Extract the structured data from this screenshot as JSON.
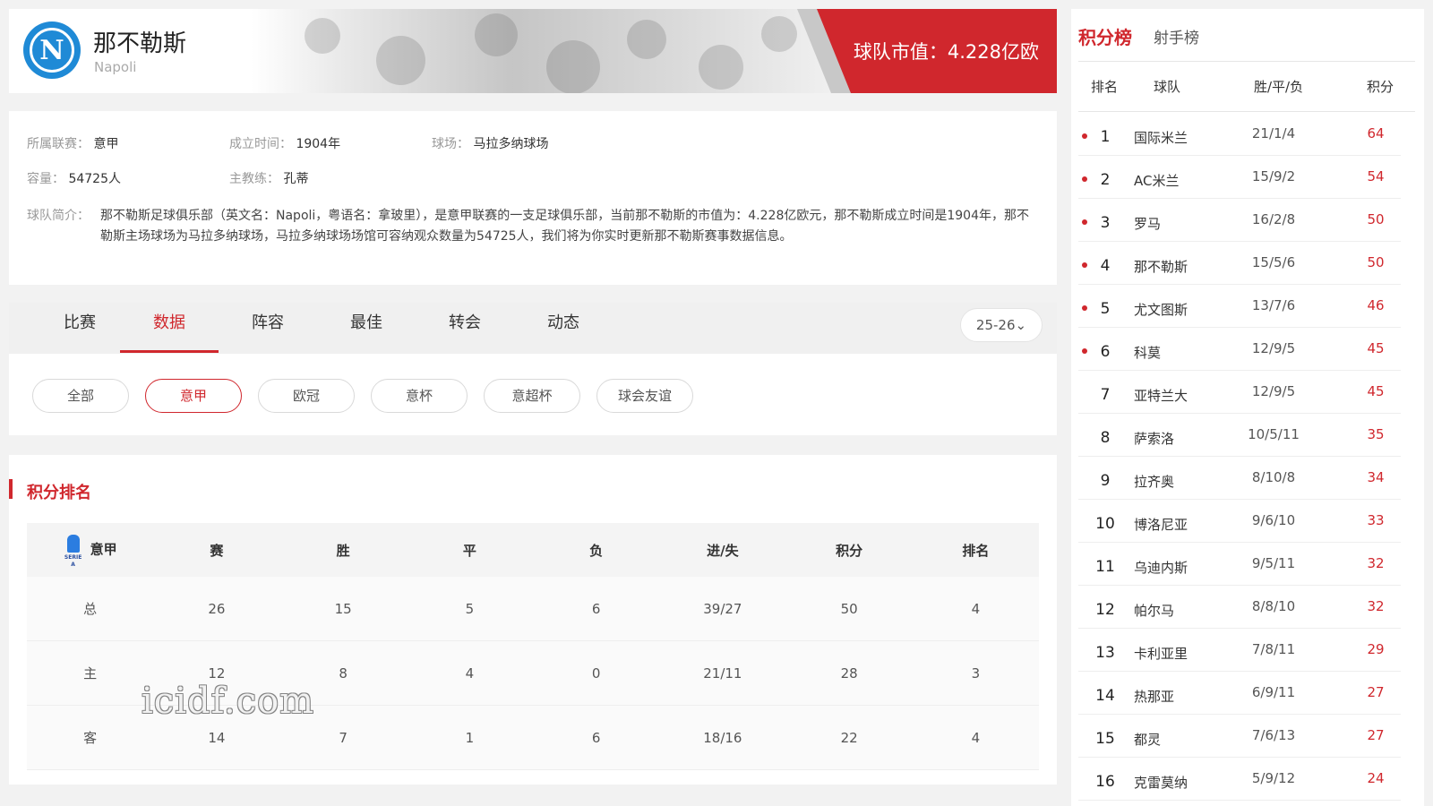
{
  "header": {
    "team_name": "那不勒斯",
    "team_name_en": "Napoli",
    "logo_letter": "N",
    "market_value": "球队市值：4.228亿欧"
  },
  "info": {
    "league_label": "所属联赛：",
    "league_value": "意甲",
    "founded_label": "成立时间：",
    "founded_value": "1904年",
    "stadium_label": "球场：",
    "stadium_value": "马拉多纳球场",
    "capacity_label": "容量：",
    "capacity_value": "54725人",
    "coach_label": "主教练：",
    "coach_value": "孔蒂",
    "intro_label": "球队简介：",
    "intro_value": "那不勒斯足球俱乐部（英文名：Napoli，粤语名：拿玻里），是意甲联赛的一支足球俱乐部，当前那不勒斯的市值为：4.228亿欧元，那不勒斯成立时间是1904年，那不勒斯主场球场为马拉多纳球场，马拉多纳球场场馆可容纳观众数量为54725人，我们将为你实时更新那不勒斯赛事数据信息。"
  },
  "tabs": [
    "比赛",
    "数据",
    "阵容",
    "最佳",
    "转会",
    "动态"
  ],
  "active_tab": "数据",
  "season": "25-26⌄",
  "filters": [
    "全部",
    "意甲",
    "欧冠",
    "意杯",
    "意超杯",
    "球会友谊"
  ],
  "active_filter": "意甲",
  "ranking": {
    "title": "积分排名",
    "logo_text": "SERIE A",
    "headers": [
      "意甲",
      "赛",
      "胜",
      "平",
      "负",
      "进/失",
      "积分",
      "排名"
    ],
    "rows": [
      [
        "总",
        "26",
        "15",
        "5",
        "6",
        "39/27",
        "50",
        "4"
      ],
      [
        "主",
        "12",
        "8",
        "4",
        "0",
        "21/11",
        "28",
        "3"
      ],
      [
        "客",
        "14",
        "7",
        "1",
        "6",
        "18/16",
        "22",
        "4"
      ]
    ]
  },
  "watermark": "icidf.com",
  "standings": {
    "tab_points": "积分榜",
    "tab_scorers": "射手榜",
    "headers": [
      "排名",
      "球队",
      "胜/平/负",
      "积分"
    ],
    "rows": [
      {
        "rank": "1",
        "team": "国际米兰",
        "wdl": "21/1/4",
        "pts": "64",
        "dot": true
      },
      {
        "rank": "2",
        "team": "AC米兰",
        "wdl": "15/9/2",
        "pts": "54",
        "dot": true
      },
      {
        "rank": "3",
        "team": "罗马",
        "wdl": "16/2/8",
        "pts": "50",
        "dot": true
      },
      {
        "rank": "4",
        "team": "那不勒斯",
        "wdl": "15/5/6",
        "pts": "50",
        "dot": true
      },
      {
        "rank": "5",
        "team": "尤文图斯",
        "wdl": "13/7/6",
        "pts": "46",
        "dot": true
      },
      {
        "rank": "6",
        "team": "科莫",
        "wdl": "12/9/5",
        "pts": "45",
        "dot": true
      },
      {
        "rank": "7",
        "team": "亚特兰大",
        "wdl": "12/9/5",
        "pts": "45",
        "dot": false
      },
      {
        "rank": "8",
        "team": "萨索洛",
        "wdl": "10/5/11",
        "pts": "35",
        "dot": false
      },
      {
        "rank": "9",
        "team": "拉齐奥",
        "wdl": "8/10/8",
        "pts": "34",
        "dot": false
      },
      {
        "rank": "10",
        "team": "博洛尼亚",
        "wdl": "9/6/10",
        "pts": "33",
        "dot": false
      },
      {
        "rank": "11",
        "team": "乌迪内斯",
        "wdl": "9/5/11",
        "pts": "32",
        "dot": false
      },
      {
        "rank": "12",
        "team": "帕尔马",
        "wdl": "8/8/10",
        "pts": "32",
        "dot": false
      },
      {
        "rank": "13",
        "team": "卡利亚里",
        "wdl": "7/8/11",
        "pts": "29",
        "dot": false
      },
      {
        "rank": "14",
        "team": "热那亚",
        "wdl": "6/9/11",
        "pts": "27",
        "dot": false
      },
      {
        "rank": "15",
        "team": "都灵",
        "wdl": "7/6/13",
        "pts": "27",
        "dot": false
      },
      {
        "rank": "16",
        "team": "克雷莫纳",
        "wdl": "5/9/12",
        "pts": "24",
        "dot": false
      }
    ]
  },
  "colors": {
    "accent": "#d0272d",
    "logo_blue": "#1f8ad6"
  }
}
